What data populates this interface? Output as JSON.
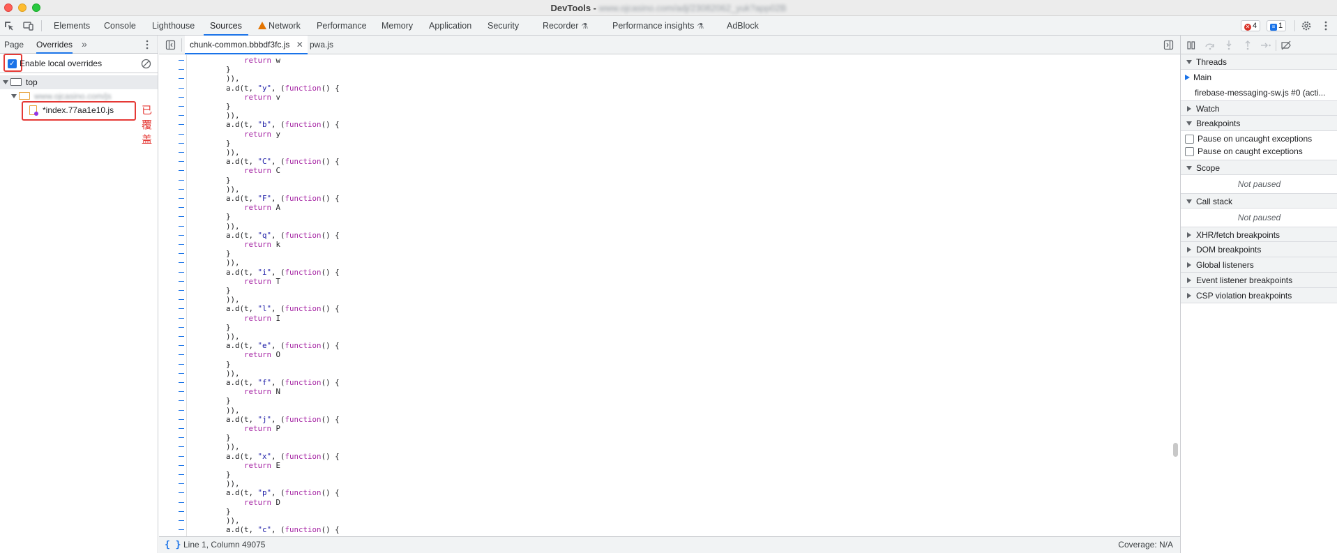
{
  "window": {
    "title_prefix": "DevTools - ",
    "title_url": "www.ojcasino.com/adj/23082062_yuk?app02B"
  },
  "toolbar": {
    "tabs": [
      {
        "label": "Elements"
      },
      {
        "label": "Console"
      },
      {
        "label": "Lighthouse"
      },
      {
        "label": "Sources"
      },
      {
        "label": "Network"
      },
      {
        "label": "Performance"
      },
      {
        "label": "Memory"
      },
      {
        "label": "Application"
      },
      {
        "label": "Security"
      },
      {
        "label": "Recorder"
      },
      {
        "label": "Performance insights"
      },
      {
        "label": "AdBlock"
      }
    ],
    "error_count": "4",
    "message_count": "1",
    "active_tab": "Sources"
  },
  "navigator": {
    "tabs": [
      {
        "label": "Page"
      },
      {
        "label": "Overrides"
      }
    ],
    "active_tab": "Overrides",
    "enable_overrides_label": "Enable local overrides",
    "enable_overrides_checked": true,
    "tree": {
      "root": "top",
      "folder": "www.ojcasino.com/js",
      "file": "*index.77aa1e10.js"
    },
    "annotation": "已覆盖"
  },
  "editor": {
    "tabs": [
      {
        "label": "chunk-common.bbbdf3fc.js",
        "closable": true
      },
      {
        "label": "pwa.js",
        "closable": false
      }
    ],
    "active_tab": "chunk-common.bbbdf3fc.js",
    "code": [
      "            return w",
      "        }",
      "        )),",
      "        a.d(t, \"y\", (function() {",
      "            return v",
      "        }",
      "        )),",
      "        a.d(t, \"b\", (function() {",
      "            return y",
      "        }",
      "        )),",
      "        a.d(t, \"C\", (function() {",
      "            return C",
      "        }",
      "        )),",
      "        a.d(t, \"F\", (function() {",
      "            return A",
      "        }",
      "        )),",
      "        a.d(t, \"q\", (function() {",
      "            return k",
      "        }",
      "        )),",
      "        a.d(t, \"i\", (function() {",
      "            return T",
      "        }",
      "        )),",
      "        a.d(t, \"l\", (function() {",
      "            return I",
      "        }",
      "        )),",
      "        a.d(t, \"e\", (function() {",
      "            return O",
      "        }",
      "        )),",
      "        a.d(t, \"f\", (function() {",
      "            return N",
      "        }",
      "        )),",
      "        a.d(t, \"j\", (function() {",
      "            return P",
      "        }",
      "        )),",
      "        a.d(t, \"x\", (function() {",
      "            return E",
      "        }",
      "        )),",
      "        a.d(t, \"p\", (function() {",
      "            return D",
      "        }",
      "        )),",
      "        a.d(t, \"c\", (function() {"
    ],
    "status": {
      "position": "Line 1, Column 49075",
      "coverage": "Coverage: N/A"
    }
  },
  "debugger": {
    "threads_label": "Threads",
    "thread_main": "Main",
    "thread_sw": "firebase-messaging-sw.js #0 (acti...",
    "watch_label": "Watch",
    "breakpoints_label": "Breakpoints",
    "pause_uncaught": "Pause on uncaught exceptions",
    "pause_caught": "Pause on caught exceptions",
    "scope_label": "Scope",
    "not_paused": "Not paused",
    "callstack_label": "Call stack",
    "xhr_label": "XHR/fetch breakpoints",
    "dom_label": "DOM breakpoints",
    "global_label": "Global listeners",
    "event_label": "Event listener breakpoints",
    "csp_label": "CSP violation breakpoints"
  },
  "colors": {
    "accent": "#1a73e8",
    "annotation": "#e53935",
    "keyword": "#a626a4",
    "string": "#1a1aa6"
  }
}
